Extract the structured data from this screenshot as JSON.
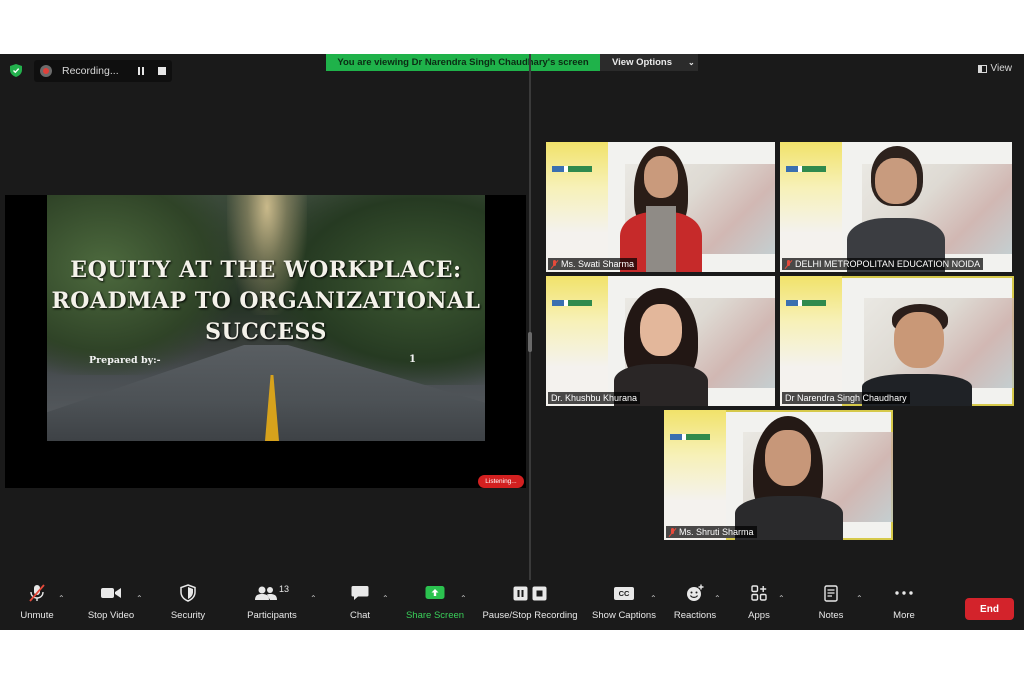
{
  "recording": {
    "label": "Recording..."
  },
  "banner": {
    "viewing_text": "You are viewing Dr Narendra Singh Chaudhary's screen",
    "view_options": "View Options"
  },
  "top_right": {
    "view": "View"
  },
  "slide": {
    "title_line1": "EQUITY AT THE WORKPLACE:",
    "title_line2": "ROADMAP TO ORGANIZATIONAL",
    "title_line3": "SUCCESS",
    "prepared_by": "Prepared by:-",
    "page_number": "1"
  },
  "status": {
    "listening": "Listening..."
  },
  "participants": [
    {
      "name": "Ms. Swati Sharma",
      "muted": true
    },
    {
      "name": "DELHI METROPOLITAN EDUCATION NOIDA",
      "muted": true
    },
    {
      "name": "Dr. Khushbu Khurana",
      "muted": false
    },
    {
      "name": "Dr Narendra Singh Chaudhary",
      "muted": false
    },
    {
      "name": "Ms. Shruti Sharma",
      "muted": true
    }
  ],
  "toolbar": {
    "unmute": "Unmute",
    "stop_video": "Stop Video",
    "security": "Security",
    "participants": "Participants",
    "participants_count": "13",
    "chat": "Chat",
    "share_screen": "Share Screen",
    "pause_stop_recording": "Pause/Stop Recording",
    "show_captions": "Show Captions",
    "captions_badge": "CC",
    "reactions": "Reactions",
    "apps": "Apps",
    "notes": "Notes",
    "more": "More",
    "end": "End"
  },
  "colors": {
    "share_green": "#1fb24a",
    "end_red": "#d3232b",
    "speaker_yellow": "#d6c94a"
  }
}
